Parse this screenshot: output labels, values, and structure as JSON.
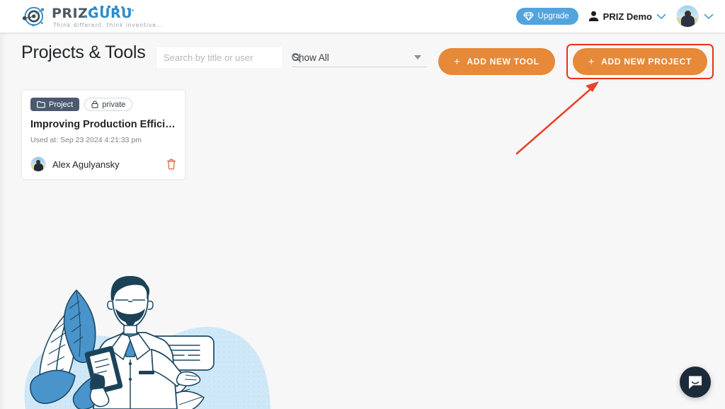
{
  "header": {
    "logo": {
      "brand_primary": "PRIZ",
      "brand_dot": ".",
      "brand_secondary": "GURU",
      "tagline": "Think different. think inventive...",
      "mark_icon": "priz-atom-icon",
      "color_blue": "#2e8bc9",
      "color_dark": "#4f5a60"
    },
    "upgrade_label": "Upgrade",
    "upgrade_icon": "gem-icon",
    "upgrade_color": "#53a3dd",
    "user_name": "PRIZ Demo",
    "user_icon": "person-icon",
    "user_chevron_icon": "chevron-down-icon",
    "avatar_icon": "avatar",
    "avatar_chevron_icon": "chevron-down-icon"
  },
  "toolbar": {
    "title": "Projects & Tools",
    "search": {
      "placeholder": "Search by title or user",
      "value": "",
      "icon": "search-icon"
    },
    "filter": {
      "selected": "Show All",
      "caret_icon": "caret-down-icon",
      "options": [
        "Show All"
      ]
    },
    "add_tool_label": "ADD NEW TOOL",
    "add_project_label": "ADD NEW PROJECT",
    "plus_icon": "plus-icon",
    "accent_orange": "#e68939",
    "highlight_color": "#e8321a"
  },
  "annotation": {
    "arrow_icon": "red-arrow-icon",
    "arrow_color": "#e8432a"
  },
  "cards": [
    {
      "type_badge": "Project",
      "type_icon": "folder-icon",
      "visibility_badge": "private",
      "visibility_icon": "lock-icon",
      "title": "Improving Production Effici…",
      "used_at": "Used at: Sep 23 2024 4:21:33 pm",
      "owner": "Alex Agulyansky",
      "delete_icon": "trash-icon",
      "delete_color": "#e2603a"
    }
  ],
  "illustration": {
    "name": "scientist-with-clipboard-illustration",
    "blob_color": "#cfe8f8",
    "line_color": "#1f4a63",
    "leaf_color": "#3f8fcb"
  },
  "chat": {
    "icon": "chat-bubble-icon",
    "color": "#1c2b3a"
  }
}
